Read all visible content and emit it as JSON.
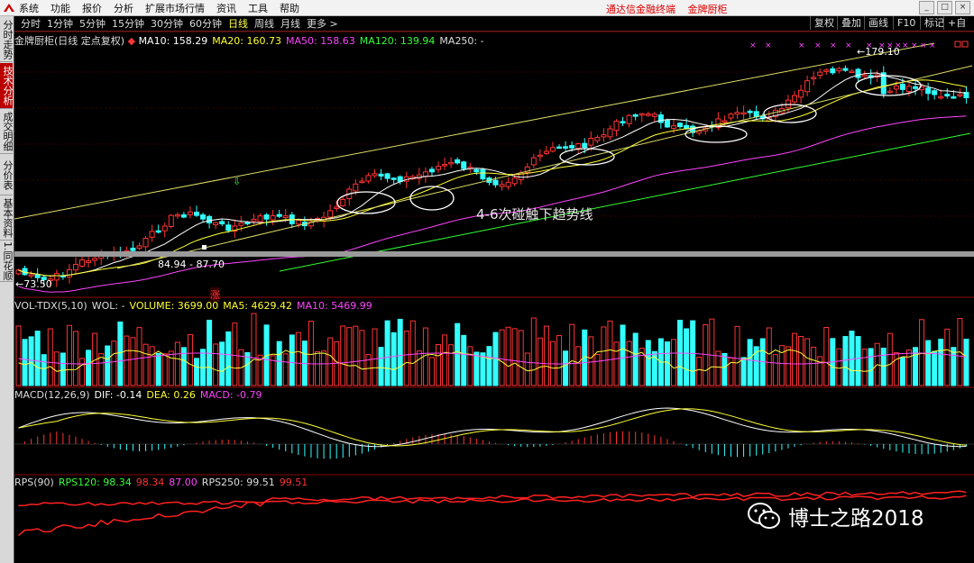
{
  "menubar": {
    "items": [
      "系统",
      "功能",
      "报价",
      "分析",
      "扩展市场行情",
      "资讯",
      "工具",
      "帮助"
    ],
    "right": [
      "通达信金融终端",
      "金牌厨柜"
    ]
  },
  "periods": {
    "items": [
      "分时",
      "1分钟",
      "5分钟",
      "15分钟",
      "30分钟",
      "60分钟",
      "日线",
      "周线",
      "月线",
      "更多 >"
    ],
    "active": "日线"
  },
  "toolbar": {
    "buttons": [
      "复权",
      "叠加",
      "画线",
      "F10",
      "标记",
      "+自"
    ]
  },
  "left_tabs": [
    {
      "label": "分时走势",
      "active": false
    },
    {
      "label": "技术分析",
      "active": true
    },
    {
      "label": "成交明细",
      "active": false
    },
    {
      "label": "分价表",
      "active": false
    },
    {
      "label": "基本资料",
      "active": false
    },
    {
      "label": "1.同花顺",
      "active": false
    }
  ],
  "main_legend": {
    "name": "金牌厨柜(日线 定点复权)",
    "items": [
      {
        "text": "MA10: 158.29",
        "color": "#ffffff"
      },
      {
        "text": "MA20: 160.73",
        "color": "#ffff33"
      },
      {
        "text": "MA50: 158.63",
        "color": "#ff44ff"
      },
      {
        "text": "MA120: 139.94",
        "color": "#33ff33"
      },
      {
        "text": "MA250: -",
        "color": "#dddddd"
      }
    ]
  },
  "price_annotations": {
    "high": "179.10",
    "low": "73.50",
    "range": "84.94 - 87.70",
    "zhang": "涨"
  },
  "annotation_text": "4-6次碰触下趋势线",
  "vol_legend": {
    "items": [
      {
        "text": "VOL-TDX(5,10)",
        "color": "#dddddd"
      },
      {
        "text": "WOL: -",
        "color": "#dddddd"
      },
      {
        "text": "VOLUME: 3699.00",
        "color": "#ffff33"
      },
      {
        "text": "MA5: 4629.42",
        "color": "#ffff33"
      },
      {
        "text": "MA10: 5469.99",
        "color": "#ff44ff"
      }
    ]
  },
  "macd_legend": {
    "items": [
      {
        "text": "MACD(12,26,9)",
        "color": "#dddddd"
      },
      {
        "text": "DIF: -0.14",
        "color": "#ffffff"
      },
      {
        "text": "DEA: 0.26",
        "color": "#ffff33"
      },
      {
        "text": "MACD: -0.79",
        "color": "#ff44ff"
      }
    ]
  },
  "rps_legend": {
    "items": [
      {
        "text": "RPS(90)",
        "color": "#dddddd"
      },
      {
        "text": "RPS120: 98.34",
        "color": "#33ff33"
      },
      {
        "text": "98.34",
        "color": "#ff3333"
      },
      {
        "text": "87.00",
        "color": "#ff44ff"
      },
      {
        "text": "RPS250: 99.51",
        "color": "#dddddd"
      },
      {
        "text": "99.51",
        "color": "#ff3333"
      }
    ]
  },
  "watermark": {
    "text": "博士之路2018",
    "icon": "wechat-icon"
  },
  "colors": {
    "up": "#ff3333",
    "down": "#33ffff",
    "ma10": "#ffffff",
    "ma20": "#ffff33",
    "ma50": "#ff44ff",
    "ma120": "#33ff33",
    "trend": "#dddd66"
  },
  "chart_data": [
    {
      "type": "candlestick",
      "title": "金牌厨柜(日线 定点复权)",
      "y_range": [
        73.5,
        179.1
      ],
      "count": 150,
      "ma_series": [
        "MA10",
        "MA20",
        "MA50",
        "MA120"
      ],
      "overlays": [
        "upper trend line",
        "lower trend line",
        "support zone 84.94 - 87.70",
        "6 ellipses marking trend line touches"
      ]
    },
    {
      "type": "bar",
      "title": "VOL-TDX(5,10)",
      "series": [
        {
          "name": "MA5"
        },
        {
          "name": "MA10"
        }
      ]
    },
    {
      "type": "bar",
      "title": "MACD(12,26,9)",
      "series": [
        {
          "name": "DIF"
        },
        {
          "name": "DEA"
        },
        {
          "name": "MACD"
        }
      ]
    },
    {
      "type": "line",
      "title": "RPS(90)",
      "series": [
        {
          "name": "RPS120"
        },
        {
          "name": "RPS250"
        }
      ]
    }
  ]
}
